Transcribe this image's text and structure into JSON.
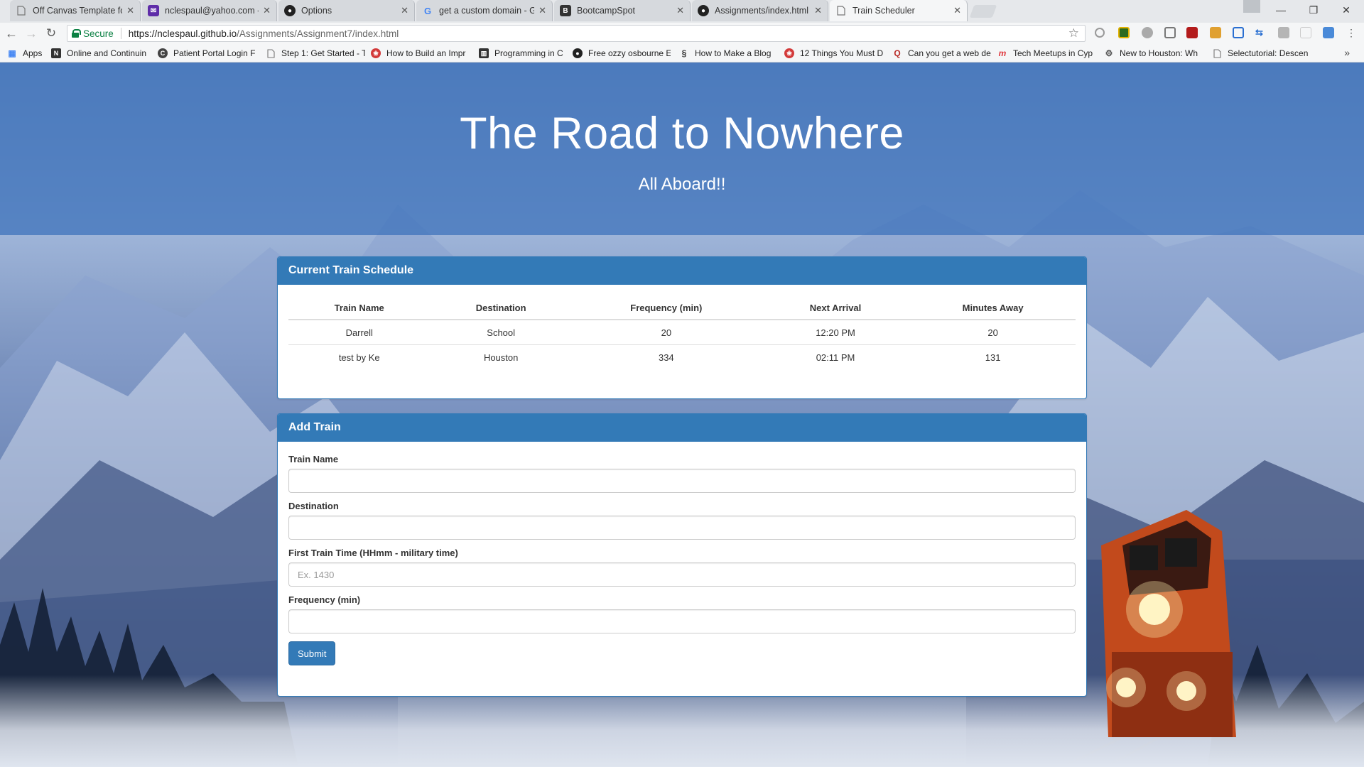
{
  "browser": {
    "tabs": [
      {
        "label": "Off Canvas Template for",
        "icon": "page-icon",
        "color": "#888888"
      },
      {
        "label": "nclespaul@yahoo.com -",
        "icon": "mail-icon",
        "color": "#5f2da8"
      },
      {
        "label": "Options",
        "icon": "github-icon",
        "color": "#222222"
      },
      {
        "label": "get a custom domain - G",
        "icon": "google-icon",
        "color": "#4285f4"
      },
      {
        "label": "BootcampSpot",
        "icon": "bootcamp-icon",
        "color": "#333333"
      },
      {
        "label": "Assignments/index.html",
        "icon": "github-icon",
        "color": "#222222"
      },
      {
        "label": "Train Scheduler",
        "icon": "page-icon",
        "color": "#888888"
      }
    ],
    "secure_label": "Secure",
    "url_host": "https://nclespaul.github.io",
    "url_path": "/Assignments/Assignment7/index.html",
    "bookmarks": [
      {
        "label": "Apps",
        "icon": "apps-grid-icon",
        "color": "#4285f4"
      },
      {
        "label": "Online and Continuin",
        "icon": "bookmark-favicon-icon",
        "color": "#333333"
      },
      {
        "label": "Patient Portal Login F",
        "icon": "bookmark-favicon-icon",
        "color": "#444444"
      },
      {
        "label": "Step 1: Get Started - T",
        "icon": "page-icon",
        "color": "#888888"
      },
      {
        "label": "How to Build an Impr",
        "icon": "bookmark-favicon-icon",
        "color": "#d33a3a"
      },
      {
        "label": "Programming in C",
        "icon": "bookmark-favicon-icon",
        "color": "#333333"
      },
      {
        "label": "Free ozzy osbourne E",
        "icon": "bookmark-favicon-icon",
        "color": "#222222"
      },
      {
        "label": "How to Make a Blog",
        "icon": "bookmark-favicon-icon",
        "color": "#333333"
      },
      {
        "label": "12 Things You Must D",
        "icon": "bookmark-favicon-icon",
        "color": "#d33a3a"
      },
      {
        "label": "Can you get a web de",
        "icon": "bookmark-favicon-icon",
        "color": "#b92b27"
      },
      {
        "label": "Tech Meetups in Cyp",
        "icon": "bookmark-favicon-icon",
        "color": "#e0393e"
      },
      {
        "label": "New to Houston: Wh",
        "icon": "bookmark-favicon-icon",
        "color": "#555555"
      },
      {
        "label": "Selectutorial: Descen",
        "icon": "page-icon",
        "color": "#888888"
      }
    ]
  },
  "header": {
    "title": "The Road to Nowhere",
    "subtitle": "All Aboard!!"
  },
  "schedule": {
    "heading": "Current Train Schedule",
    "columns": [
      "Train Name",
      "Destination",
      "Frequency (min)",
      "Next Arrival",
      "Minutes Away"
    ],
    "rows": [
      [
        "Darrell",
        "School",
        "20",
        "12:20 PM",
        "20"
      ],
      [
        "test by Ke",
        "Houston",
        "334",
        "02:11 PM",
        "131"
      ]
    ]
  },
  "form": {
    "heading": "Add Train",
    "fields": [
      {
        "label": "Train Name",
        "placeholder": "",
        "value": ""
      },
      {
        "label": "Destination",
        "placeholder": "",
        "value": ""
      },
      {
        "label": "First Train Time (HHmm - military time)",
        "placeholder": "Ex. 1430",
        "value": ""
      },
      {
        "label": "Frequency (min)",
        "placeholder": "",
        "value": ""
      }
    ],
    "submit_label": "Submit"
  },
  "colors": {
    "accent": "#337ab7",
    "jumbotron": "#3a70ba",
    "secure_green": "#0b8043"
  }
}
